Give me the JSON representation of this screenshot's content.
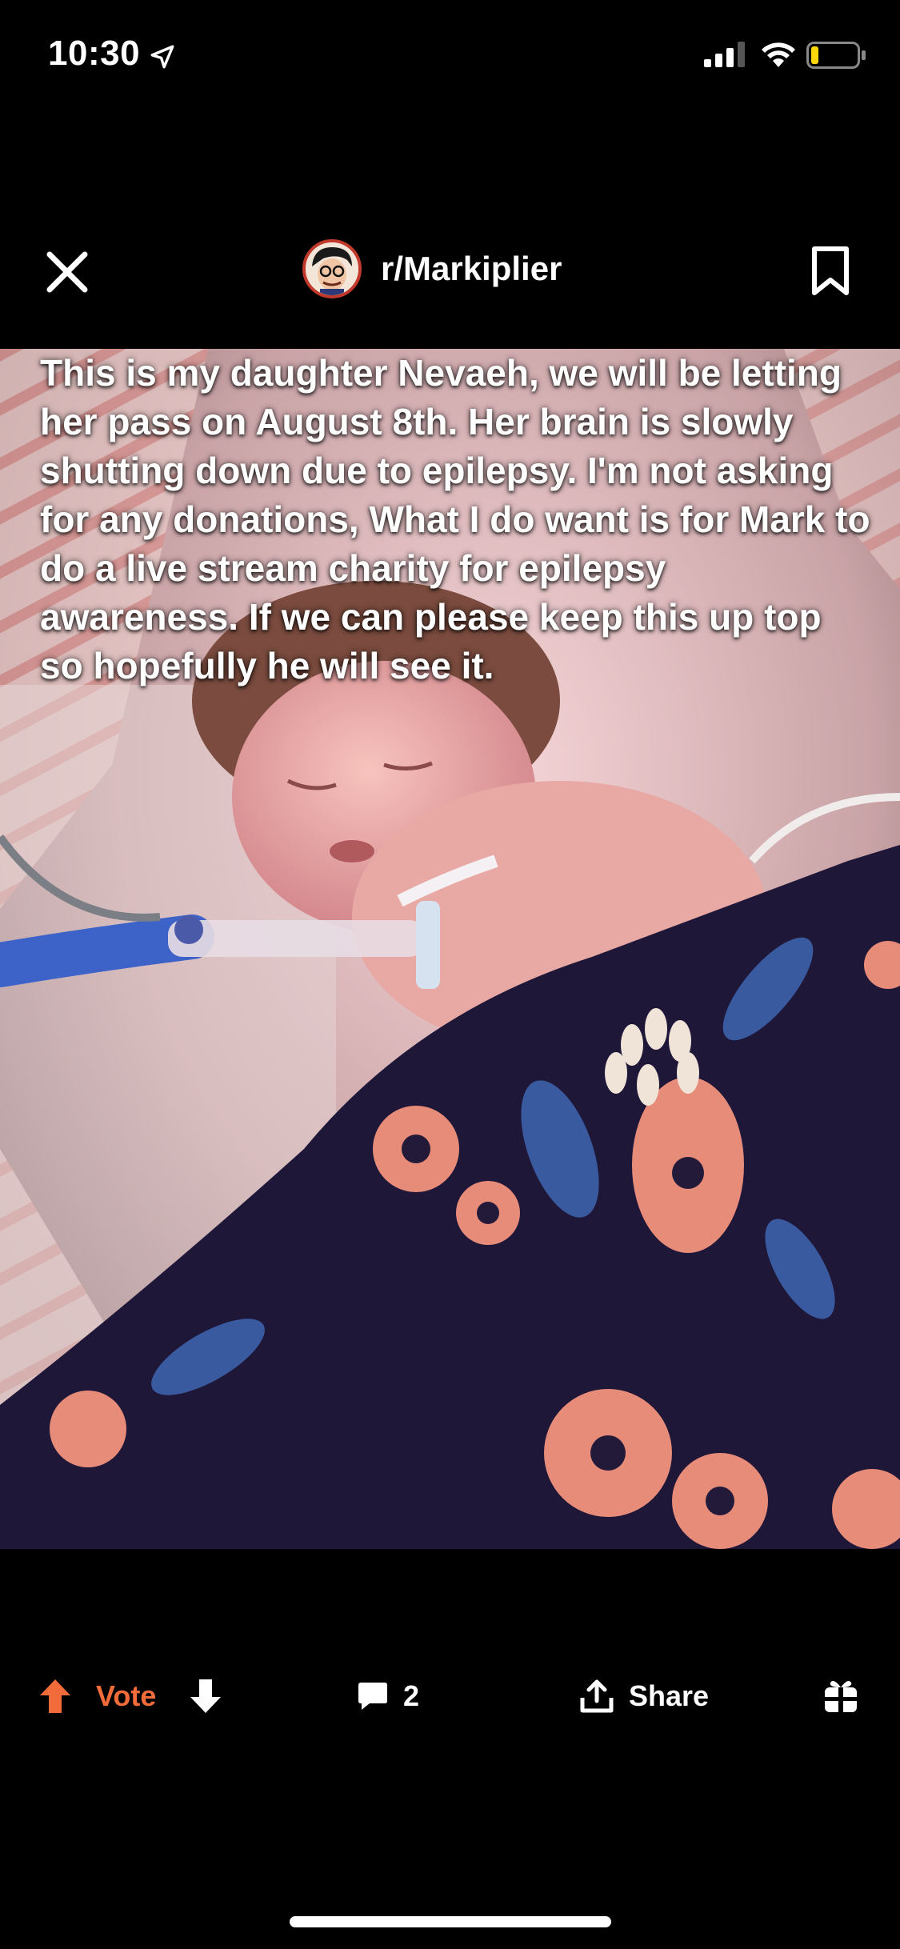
{
  "status_bar": {
    "time": "10:30"
  },
  "post": {
    "subreddit": "r/Markiplier",
    "caption": "This is my daughter Nevaeh, we will be letting her pass on August 8th. Her brain is slowly shutting down due to epilepsy. I'm not asking for any donations, What I do want is for Mark to do a live stream charity for epilepsy awareness. If we can please keep this up top so hopefully he will see it."
  },
  "actions": {
    "vote_label": "Vote",
    "comment_count": "2",
    "share_label": "Share"
  },
  "icons": {
    "close": "close-icon",
    "bookmark": "bookmark-icon",
    "upvote": "upvote-arrow-icon",
    "downvote": "downvote-arrow-icon",
    "comment": "comment-bubble-icon",
    "share": "share-icon",
    "award": "gift-icon"
  },
  "colors": {
    "background": "#000000",
    "accent": "#f26b3a",
    "text": "#ffffff"
  }
}
